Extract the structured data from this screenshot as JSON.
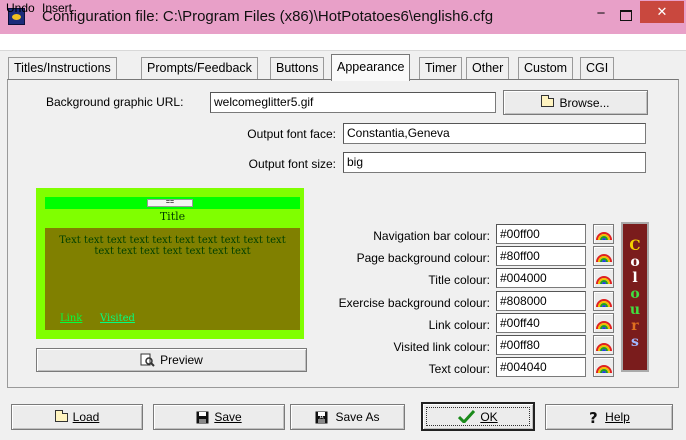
{
  "window": {
    "title": "Configuration file: C:\\Program Files (x86)\\HotPotatoes6\\english6.cfg",
    "minimize_glyph": "−",
    "close_glyph": "✕"
  },
  "menu": [
    "Undo",
    "Insert"
  ],
  "tabs": [
    "Titles/Instructions",
    "Prompts/Feedback",
    "Buttons",
    "Appearance",
    "Timer",
    "Other",
    "Custom",
    "CGI"
  ],
  "active_tab": "Appearance",
  "form": {
    "bg_url_label": "Background graphic URL:",
    "bg_url_value": "welcomeglitter5.gif",
    "browse_label": "Browse...",
    "font_face_label": "Output font face:",
    "font_face_value": "Constantia,Geneva",
    "font_size_label": "Output font size:",
    "font_size_value": "big"
  },
  "preview": {
    "nav_button": "==",
    "title": "Title",
    "body_text": "Text text text text text text text text text text text text text text text text text",
    "link": "Link",
    "visited": "Visited",
    "button_label": "Preview"
  },
  "colours": [
    {
      "label": "Navigation bar colour:",
      "value": "#00ff00"
    },
    {
      "label": "Page background colour:",
      "value": "#80ff00"
    },
    {
      "label": "Title colour:",
      "value": "#004000"
    },
    {
      "label": "Exercise background colour:",
      "value": "#808000"
    },
    {
      "label": "Link colour:",
      "value": "#00ff40"
    },
    {
      "label": "Visited link colour:",
      "value": "#00ff80"
    },
    {
      "label": "Text colour:",
      "value": "#004040"
    }
  ],
  "colours_banner": [
    "C",
    "o",
    "l",
    "o",
    "u",
    "r",
    "s"
  ],
  "buttons": {
    "load": "Load",
    "save": "Save",
    "save_as": "Save As",
    "ok": "OK",
    "help": "Help"
  },
  "icons": {
    "app": "hotpotatoes-app-icon",
    "folder": "folder-icon",
    "preview": "magnifier-page-icon",
    "save": "floppy-disk-icon",
    "save_as": "floppy-disk-as-icon",
    "ok": "checkmark-icon",
    "help": "question-mark-icon",
    "palette": "rainbow-palette-icon"
  },
  "theme_colors": {
    "titlebar": "#e8a0c8",
    "close": "#c9483e"
  }
}
